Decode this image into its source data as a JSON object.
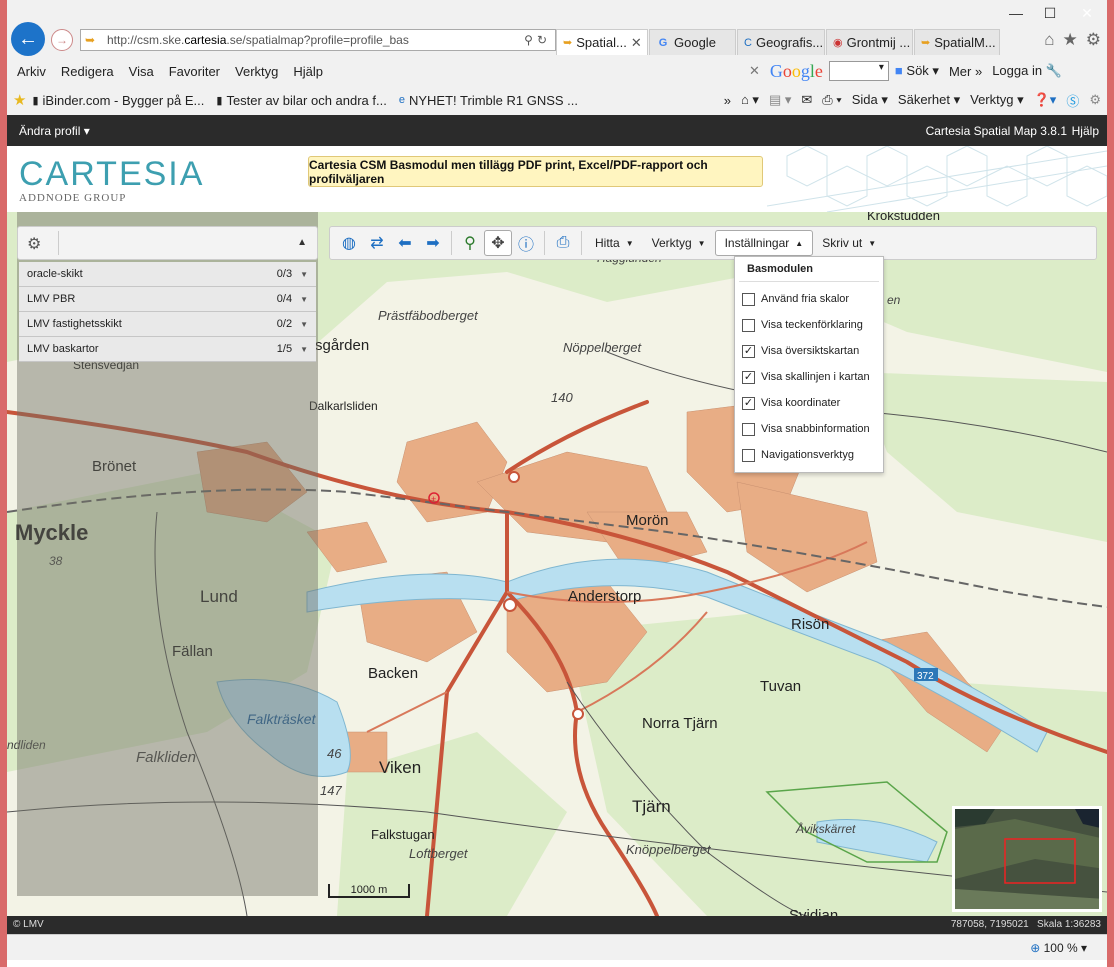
{
  "browser": {
    "url_prefix": "http://csm.ske.",
    "url_domain": "cartesia",
    "url_suffix": ".se/spatialmap?profile=profile_bas",
    "tabs": [
      {
        "label": "Spatial...",
        "active": true
      },
      {
        "label": "Google"
      },
      {
        "label": "Geografis..."
      },
      {
        "label": "Grontmij ..."
      },
      {
        "label": "SpatialM..."
      }
    ],
    "menu": [
      "Arkiv",
      "Redigera",
      "Visa",
      "Favoriter",
      "Verktyg",
      "Hjälp"
    ],
    "google": {
      "search_label": "Sök",
      "more_label": "Mer",
      "login_label": "Logga in"
    },
    "favorites": [
      "iBinder.com - Bygger på E...",
      "Tester av bilar och andra f...",
      "NYHET! Trimble R1 GNSS ..."
    ],
    "command_bar": {
      "page_label": "Sida",
      "safety_label": "Säkerhet",
      "tools_label": "Verktyg"
    },
    "zoom": "100 %"
  },
  "app": {
    "profile_label": "Ändra profil",
    "version": "Cartesia Spatial Map 3.8.1",
    "help_label": "Hjälp",
    "logo_main": "CARTESIA",
    "logo_sub": "ADDNODE GROUP",
    "banner": "Cartesia CSM Basmodul men tillägg PDF print, Excel/PDF-rapport och profilväljaren",
    "layers": [
      {
        "name": "oracle-skikt",
        "count": "0/3"
      },
      {
        "name": "LMV PBR",
        "count": "0/4"
      },
      {
        "name": "LMV fastighetsskikt",
        "count": "0/2"
      },
      {
        "name": "LMV baskartor",
        "count": "1/5"
      }
    ],
    "toolbar_menus": {
      "find": "Hitta",
      "tools": "Verktyg",
      "settings": "Inställningar",
      "print": "Skriv ut"
    },
    "settings_menu": {
      "title": "Basmodulen",
      "options": [
        {
          "label": "Använd fria skalor",
          "checked": false
        },
        {
          "label": "Visa teckenförklaring",
          "checked": false
        },
        {
          "label": "Visa översiktskartan",
          "checked": true
        },
        {
          "label": "Visa skallinjen i kartan",
          "checked": true
        },
        {
          "label": "Visa koordinater",
          "checked": true
        },
        {
          "label": "Visa snabbinformation",
          "checked": false
        },
        {
          "label": "Navigationsverktyg",
          "checked": false
        }
      ]
    },
    "scalebar_label": "1000 m",
    "copyright": "© LMV",
    "coordinates": "787058, 7195021",
    "scale": "Skala 1:36283"
  },
  "map_labels": {
    "krokstudden": "Krokstudden",
    "hagglunden": "Hagglunden",
    "prastfabodberget": "Prästfäbodberget",
    "noppelberget": "Nöppelberget",
    "sgarden": "sgården",
    "stensvedjan": "Stensvedjan",
    "dalkarlsliden": "Dalkarlsliden",
    "bronet": "Brönet",
    "mycklе": "Myckle",
    "h38": "38",
    "lund": "Lund",
    "fallan": "Fällan",
    "moron": "Morön",
    "anderstorp": "Anderstorp",
    "rison": "Risön",
    "backen": "Backen",
    "tuvan": "Tuvan",
    "norra_tjarn": "Norra Tjärn",
    "falktrasket": "Falkträsket",
    "h46": "46",
    "viken": "Viken",
    "falkliden": "Falkliden",
    "ndliden": "ndliden",
    "h147": "147",
    "h140": "140",
    "tjarn": "Tjärn",
    "falkstugan": "Falkstugan",
    "loftberget": "Loftberget",
    "knoppelberget": "Knöppelberget",
    "avikskarret": "Åvikskärret",
    "svidjan": "Svidjan",
    "road372": "372",
    "en": "en"
  },
  "colors": {
    "urban": "#e8ad85",
    "forest": "#dcecc8",
    "water": "#b8dff0",
    "road": "#c8553a",
    "accent": "#3d9fb0"
  }
}
